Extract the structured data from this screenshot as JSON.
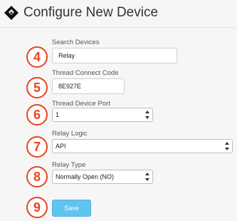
{
  "header": {
    "title": "Configure New Device"
  },
  "steps": [
    "4",
    "5",
    "6",
    "7",
    "8",
    "9"
  ],
  "search": {
    "label": "Search Devices",
    "value": "Relay"
  },
  "thread_code": {
    "label": "Thread Connect Code",
    "value": "8E927E"
  },
  "thread_port": {
    "label": "Thread Device Port",
    "value": "1"
  },
  "relay_logic": {
    "label": "Relay Logic",
    "value": "API"
  },
  "relay_type": {
    "label": "Relay Type",
    "value": "Normally Open (NO)"
  },
  "save": {
    "label": "Save"
  },
  "colors": {
    "accent": "#e8451e",
    "button": "#62c3ef"
  },
  "icons": {
    "logo": "diamond-logo-icon",
    "select_arrows": "updown-arrows-icon"
  }
}
